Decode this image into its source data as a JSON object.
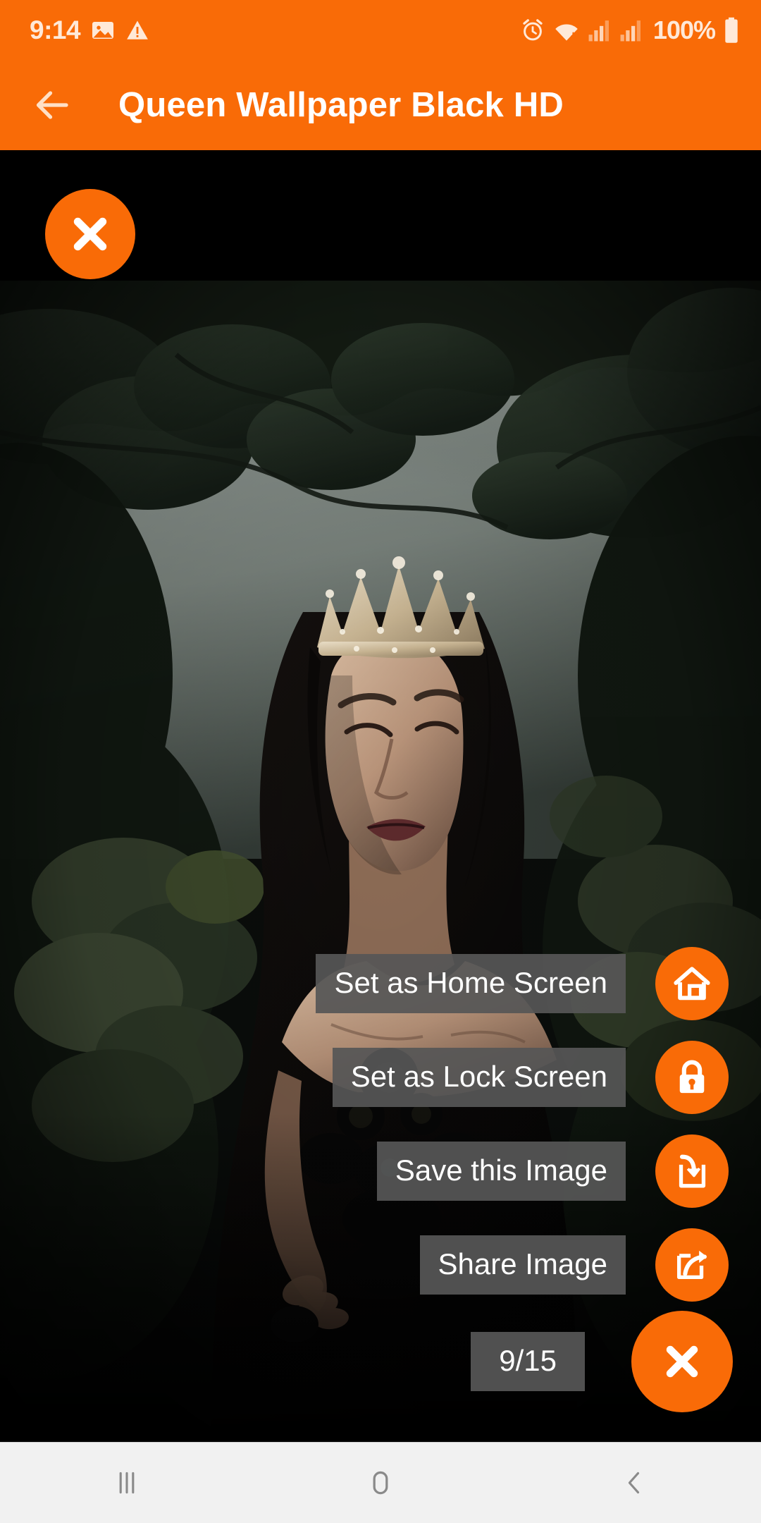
{
  "status_bar": {
    "time": "9:14",
    "battery_text": "100%",
    "left_icons": [
      "image-icon",
      "warning-icon"
    ],
    "right_icons": [
      "alarm-icon",
      "wifi-icon",
      "signal-icon-1",
      "signal-icon-2",
      "battery-icon"
    ]
  },
  "app_bar": {
    "title": "Queen Wallpaper Black HD",
    "back_icon": "arrow-left-icon",
    "background_color": "#F96B07"
  },
  "overlay": {
    "top_close_icon": "close-icon"
  },
  "wallpaper": {
    "description": "Dark fantasy photo of a woman wearing a jeweled crown standing amid dark green foliage with misty grey sky",
    "dominant_colors": [
      "#0a0d0a",
      "#2b332b",
      "#8f9a94",
      "#c8b9a6"
    ]
  },
  "actions": [
    {
      "id": "set-home-screen",
      "label": "Set as Home Screen",
      "icon": "home-icon"
    },
    {
      "id": "set-lock-screen",
      "label": "Set as Lock Screen",
      "icon": "lock-icon"
    },
    {
      "id": "save-image",
      "label": "Save this Image",
      "icon": "save-download-icon"
    },
    {
      "id": "share-image",
      "label": "Share Image",
      "icon": "share-icon"
    },
    {
      "id": "close-menu",
      "label": "9/15",
      "icon": "close-icon"
    }
  ],
  "counter": {
    "current": 9,
    "total": 15,
    "display": "9/15"
  },
  "nav_bar": {
    "recents_icon": "recents-icon",
    "home_icon": "home-square-icon",
    "back_icon": "back-chevron-icon",
    "background_color": "#F1F1F1"
  },
  "theme": {
    "accent": "#F96B07",
    "label_bg": "#565656",
    "text_on_accent": "#FFFFFF"
  }
}
